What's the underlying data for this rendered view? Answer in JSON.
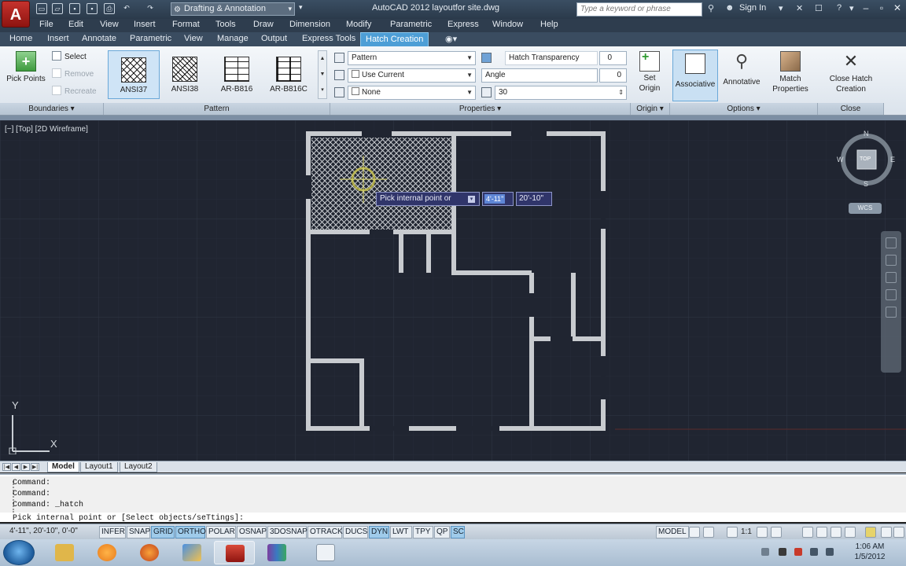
{
  "window": {
    "title": "AutoCAD 2012    layoutfor site.dwg",
    "workspace": "Drafting & Annotation",
    "search_placeholder": "Type a keyword or phrase",
    "sign_in": "Sign In"
  },
  "menu": [
    "File",
    "Edit",
    "View",
    "Insert",
    "Format",
    "Tools",
    "Draw",
    "Dimension",
    "Modify",
    "Parametric",
    "Express",
    "Window",
    "Help"
  ],
  "ribbon_tabs": [
    "Home",
    "Insert",
    "Annotate",
    "Parametric",
    "View",
    "Manage",
    "Output",
    "Express Tools",
    "Hatch Creation"
  ],
  "active_tab": "Hatch Creation",
  "ribbon": {
    "boundaries": {
      "pick_points": "Pick Points",
      "select": "Select",
      "remove": "Remove",
      "recreate": "Recreate",
      "footer": "Boundaries ▾"
    },
    "pattern": {
      "swatches": [
        "ANSI37",
        "ANSI38",
        "AR-B816",
        "AR-B816C"
      ],
      "selected": "ANSI37",
      "footer": "Pattern"
    },
    "properties": {
      "type": "Pattern",
      "color": "Use Current",
      "background": "None",
      "transparency_label": "Hatch Transparency",
      "transparency_value": "0",
      "angle_label": "Angle",
      "angle_value": "0",
      "scale_value": "30",
      "footer": "Properties ▾"
    },
    "origin": {
      "set_origin": "Set Origin",
      "footer": "Origin ▾"
    },
    "options": {
      "associative": "Associative",
      "annotative": "Annotative",
      "match_properties": "Match Properties",
      "footer": "Options ▾"
    },
    "close": {
      "label": "Close Hatch Creation",
      "footer": "Close"
    }
  },
  "viewport": {
    "label": "[−] [Top] [2D Wireframe]",
    "compass": {
      "n": "N",
      "s": "S",
      "e": "E",
      "w": "W",
      "top": "TOP"
    },
    "wcs": "WCS",
    "ucs_x": "X",
    "ucs_y": "Y"
  },
  "dynamic_input": {
    "prompt": "Pick internal point or",
    "x_value": "4'-11\"",
    "y_value": "20'-10\""
  },
  "layout_tabs": [
    "Model",
    "Layout1",
    "Layout2"
  ],
  "active_layout": "Model",
  "command": {
    "history": [
      "Command:",
      "Command:",
      "Command: _hatch"
    ],
    "prompt": "Pick internal point or [Select objects/seTtings]:"
  },
  "status": {
    "coords": "4'-11\", 20'-10\", 0'-0\"",
    "toggles": [
      {
        "label": "INFER",
        "on": false
      },
      {
        "label": "SNAP",
        "on": false
      },
      {
        "label": "GRID",
        "on": true
      },
      {
        "label": "ORTHO",
        "on": true
      },
      {
        "label": "POLAR",
        "on": false
      },
      {
        "label": "OSNAP",
        "on": false
      },
      {
        "label": "3DOSNAP",
        "on": false
      },
      {
        "label": "OTRACK",
        "on": false
      },
      {
        "label": "DUCS",
        "on": false
      },
      {
        "label": "DYN",
        "on": true
      },
      {
        "label": "LWT",
        "on": false
      },
      {
        "label": "TPY",
        "on": false
      },
      {
        "label": "QP",
        "on": false
      },
      {
        "label": "SC",
        "on": true
      }
    ],
    "model": "MODEL",
    "scale": "1:1"
  },
  "taskbar": {
    "time": "1:06 AM",
    "date": "1/5/2012"
  }
}
